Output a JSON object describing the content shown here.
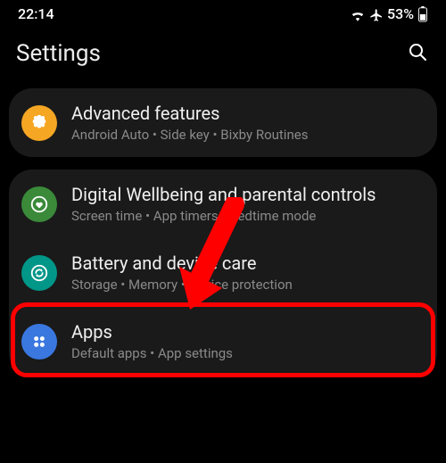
{
  "statusbar": {
    "time": "22:14",
    "battery_pct": "53%"
  },
  "header": {
    "title": "Settings"
  },
  "items": {
    "advanced": {
      "title": "Advanced features",
      "sub": "Android Auto  •  Side key  •  Bixby Routines",
      "icon_bg": "#f5a623",
      "icon_fg": "#ffffff"
    },
    "wellbeing": {
      "title": "Digital Wellbeing and parental controls",
      "sub": "Screen time  •  App timers  •  Bedtime mode",
      "icon_bg": "#3a8a3a",
      "icon_fg": "#ffffff"
    },
    "battery": {
      "title": "Battery and device care",
      "sub": "Storage  •  Memory  •  Device protection",
      "icon_bg": "#009688",
      "icon_fg": "#ffffff"
    },
    "apps": {
      "title": "Apps",
      "sub": "Default apps  •  App settings",
      "icon_bg": "#3a78e0",
      "icon_fg": "#ffffff"
    }
  }
}
